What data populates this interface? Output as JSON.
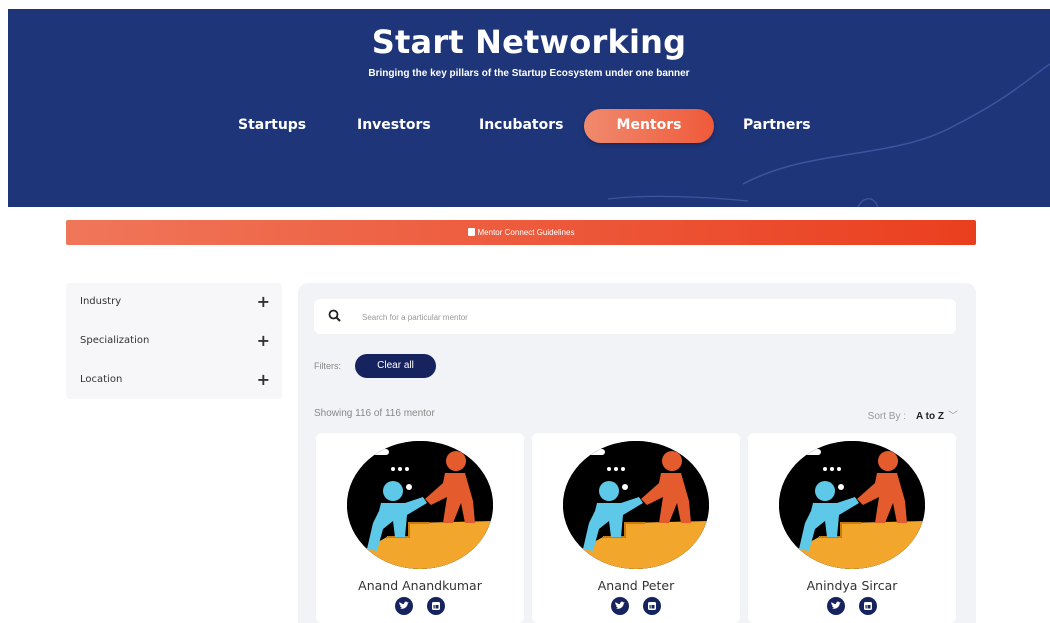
{
  "hero": {
    "title": "Start Networking",
    "subtitle": "Bringing the key pillars of the Startup Ecosystem under one banner",
    "tabs": [
      {
        "label": "Startups",
        "active": false
      },
      {
        "label": "Investors",
        "active": false
      },
      {
        "label": "Incubators",
        "active": false
      },
      {
        "label": "Mentors",
        "active": true
      },
      {
        "label": "Partners",
        "active": false
      }
    ]
  },
  "guidelines": {
    "label": "Mentor Connect Guidelines",
    "icon": "document-icon"
  },
  "sidebar": {
    "filters": [
      {
        "label": "Industry",
        "icon": "plus-icon"
      },
      {
        "label": "Specialization",
        "icon": "plus-icon"
      },
      {
        "label": "Location",
        "icon": "plus-icon"
      }
    ]
  },
  "search": {
    "placeholder": "Search for a particular mentor",
    "icon": "search-icon"
  },
  "filters": {
    "label": "Filters:",
    "clear_label": "Clear all"
  },
  "results": {
    "showing": "Showing 116 of 116 mentor"
  },
  "sort": {
    "label": "Sort By :",
    "value": "A to Z",
    "icon": "chevron-down-icon"
  },
  "mentors": [
    {
      "name": "Anand Anandkumar",
      "socials": [
        "twitter-icon",
        "linkedin-icon"
      ]
    },
    {
      "name": "Anand Peter",
      "socials": [
        "twitter-icon",
        "linkedin-icon"
      ]
    },
    {
      "name": "Anindya Sircar",
      "socials": [
        "twitter-icon",
        "linkedin-icon"
      ]
    }
  ],
  "colors": {
    "hero_bg": "#1e3579",
    "accent": "#ef5a3a",
    "navy": "#16235e",
    "panel_bg": "#f2f3f7"
  }
}
